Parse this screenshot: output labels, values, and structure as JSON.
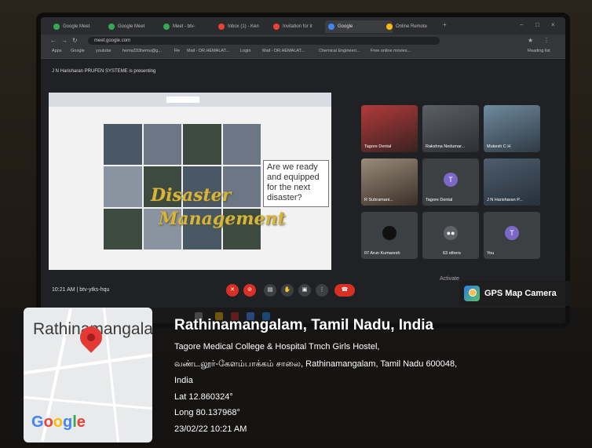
{
  "browser": {
    "tabs": [
      "Google Meet",
      "Google Meet",
      "Meet - btv-",
      "Inbox (1) - Ken",
      "Invitation for Ir",
      "Google",
      "Online Remote"
    ],
    "url": "meet.google.com",
    "bookmarks": [
      "Apps",
      "Google",
      "youtube",
      "hema333hemu@g...",
      "Re",
      "Mail - DR.HEMALAT...",
      "Login",
      "Mail - DR.HEMALAT...",
      "Chemical Engineeri...",
      "Free online movies...",
      "Reading list"
    ]
  },
  "meet": {
    "presenting_text": "J N Harisharan PRUFEN SYSTEME is presenting",
    "slide": {
      "question": "Are we ready and equipped for the next disaster?",
      "overlay_word_1": "Disaster",
      "overlay_word_2": "Management"
    },
    "participants": [
      {
        "name": "Tagore Dental",
        "type": "photo"
      },
      {
        "name": "Rakshna Nedumar...",
        "type": "photo"
      },
      {
        "name": "Mukesh C H",
        "type": "photo"
      },
      {
        "name": "R Subramani...",
        "type": "photo"
      },
      {
        "name": "Tagore Dental",
        "type": "avatar",
        "initial": "T"
      },
      {
        "name": "J N Harisharan P...",
        "type": "photo"
      },
      {
        "name": "07 Arun Kumaresh",
        "type": "dark"
      },
      {
        "name": "63 others",
        "type": "others"
      },
      {
        "name": "You",
        "type": "avatar",
        "initial": "T"
      }
    ],
    "time_code": "10:21 AM  |  btv-ytks-hqu",
    "activate_text": "Activate"
  },
  "gps": {
    "app_name": "GPS Map Camera",
    "map_place": "Rathinamangalam",
    "map_logo": "Google",
    "title": "Rathinamangalam, Tamil Nadu, India",
    "address_1": "Tagore Medical College & Hospital Tmch Girls Hostel,",
    "address_2": "வண்டலூர்-கேளம்பாக்கம் சாலை, Rathinamangalam, Tamil Nadu 600048,",
    "address_3": "India",
    "lat": "Lat 12.860324°",
    "long": "Long 80.137968°",
    "datetime": "23/02/22 10:21 AM"
  },
  "colors": {
    "meet_red": "#d93025",
    "avatar_purple": "#7b68c7",
    "slide_word": "#d6b53a"
  }
}
